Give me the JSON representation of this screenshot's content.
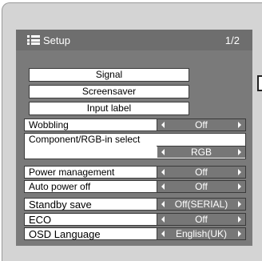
{
  "header": {
    "title": "Setup",
    "page": "1/2"
  },
  "buttons": [
    {
      "label": "Signal"
    },
    {
      "label": "Screensaver"
    },
    {
      "label": "Input label"
    }
  ],
  "settings": {
    "wobbling": {
      "label": "Wobbling",
      "value": "Off"
    },
    "component_rgb": {
      "label": "Component/RGB-in select",
      "value": "RGB"
    },
    "power_management": {
      "label": "Power management",
      "value": "Off"
    },
    "auto_power_off": {
      "label": "Auto power off",
      "value": "Off"
    },
    "standby_save": {
      "label": "Standby save",
      "value": "Off(SERIAL)"
    },
    "eco": {
      "label": "ECO",
      "value": "Off"
    },
    "osd_language": {
      "label": "OSD Language",
      "value": "English(UK)"
    }
  },
  "colors": {
    "panel": "#7a7a7a",
    "header": "#6e6e6e",
    "value_bg": "#777777",
    "frame": "#d4d4d4"
  },
  "icons": {
    "menu": "setup-menu-icon",
    "left": "arrow-left-icon",
    "right": "arrow-right-icon"
  }
}
